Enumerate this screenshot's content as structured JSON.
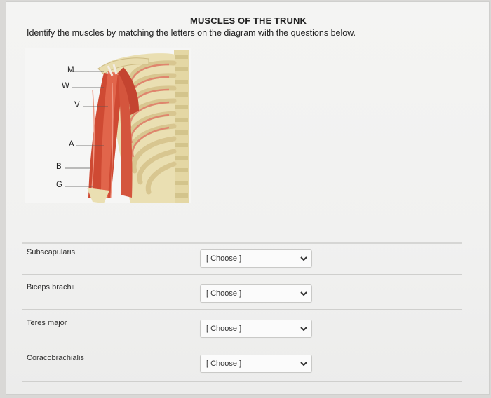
{
  "page": {
    "title": "MUSCLES OF THE TRUNK",
    "instructions": "Identify the muscles by matching the letters on the diagram with the questions below."
  },
  "diagram": {
    "labels": [
      "M",
      "W",
      "V",
      "A",
      "B",
      "G"
    ],
    "colors": {
      "muscle": "#d9543c",
      "bone": "#e8dcae",
      "background": "#f6f6f5"
    }
  },
  "questions": [
    {
      "prompt": "Subscapularis",
      "selected": "[ Choose ]",
      "icon": "chevron-down-icon"
    },
    {
      "prompt": "Biceps brachii",
      "selected": "[ Choose ]",
      "icon": "chevron-down-icon"
    },
    {
      "prompt": "Teres major",
      "selected": "[ Choose ]",
      "icon": "chevron-down-icon"
    },
    {
      "prompt": "Coracobrachialis",
      "selected": "[ Choose ]",
      "icon": "chevron-down-icon"
    }
  ]
}
